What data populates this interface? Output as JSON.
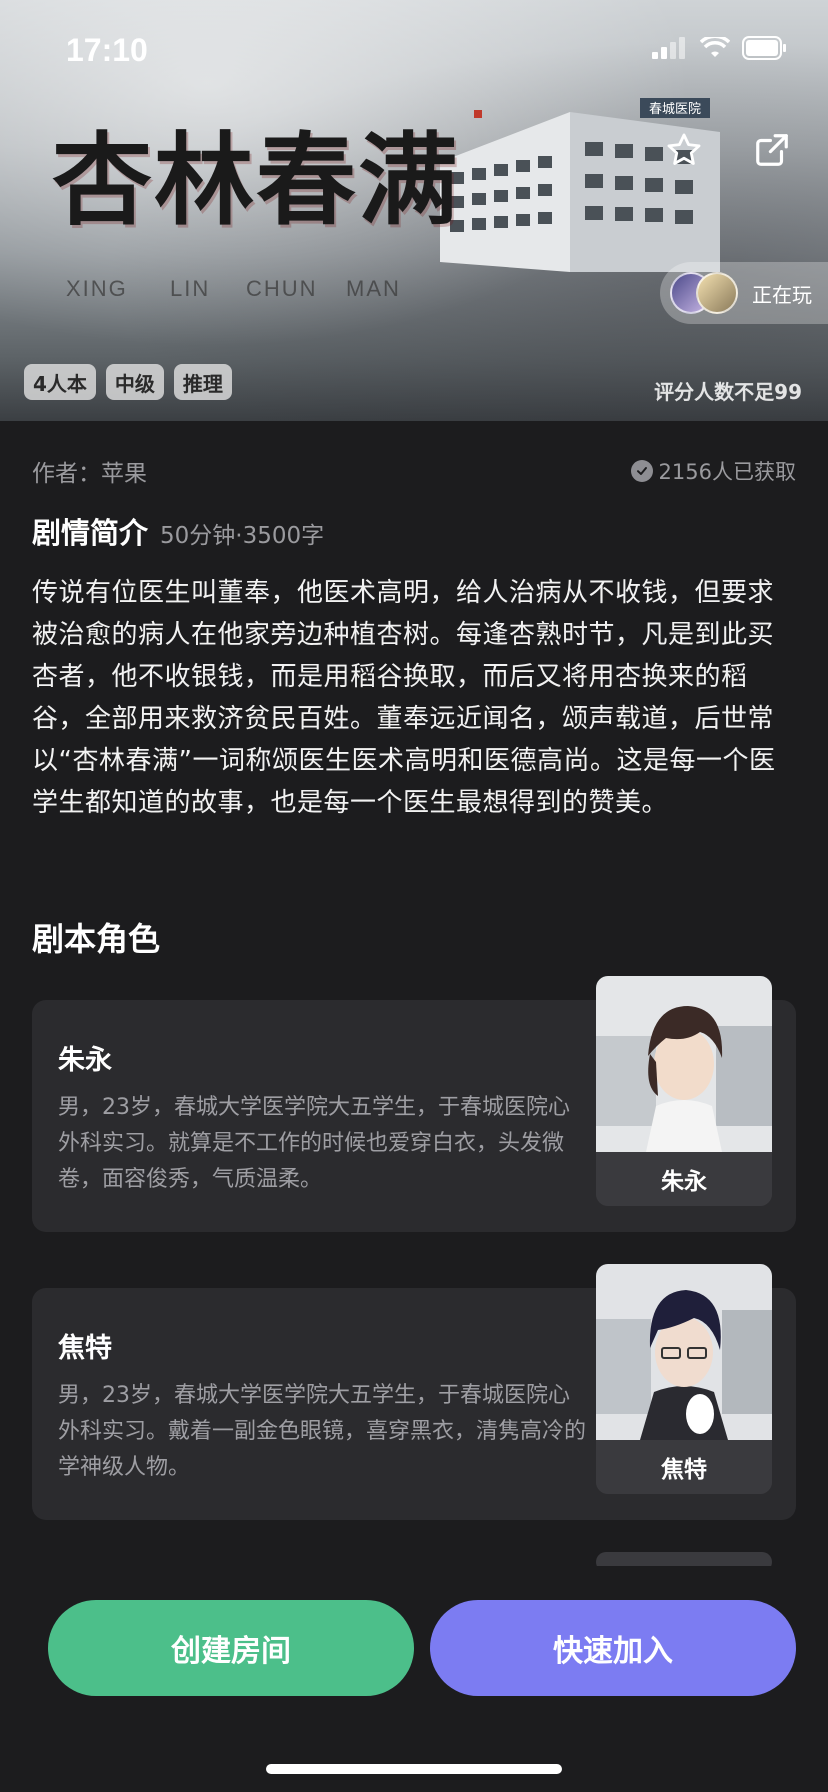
{
  "status_bar": {
    "time": "17:10"
  },
  "banner": {
    "title": "杏林春满",
    "pinyin": [
      "XING",
      "LIN",
      "CHUN",
      "MAN"
    ],
    "building_sign": "春城医院",
    "playing_label": "正在玩",
    "tags": [
      "4人本",
      "中级",
      "推理"
    ],
    "rating_note": "评分人数不足99"
  },
  "meta": {
    "author": "作者：苹果",
    "obtained": "2156人已获取"
  },
  "synopsis": {
    "title": "剧情简介",
    "meta": "50分钟·3500字",
    "body": "传说有位医生叫董奉，他医术高明，给人治病从不收钱，但要求被治愈的病人在他家旁边种植杏树。每逢杏熟时节，凡是到此买杏者，他不收银钱，而是用稻谷换取，而后又将用杏换来的稻谷，全部用来救济贫民百姓。董奉远近闻名，颂声载道，后世常以“杏林春满”一词称颂医生医术高明和医德高尚。这是每一个医学生都知道的故事，也是每一个医生最想得到的赞美。"
  },
  "roles": {
    "title": "剧本角色",
    "items": [
      {
        "name": "朱永",
        "desc": "男，23岁，春城大学医学院大五学生，于春城医院心外科实习。就算是不工作的时候也爱穿白衣，头发微卷，面容俊秀，气质温柔。",
        "portrait_label": "朱永"
      },
      {
        "name": "焦特",
        "desc": "男，23岁，春城大学医学院大五学生，于春城医院心外科实习。戴着一副金色眼镜，喜穿黑衣，清隽高冷的学神级人物。",
        "portrait_label": "焦特"
      }
    ]
  },
  "actions": {
    "create_label": "创建房间",
    "join_label": "快速加入"
  },
  "colors": {
    "background": "#1c1c1e",
    "card": "#2b2b2e",
    "create_button": "#4cbf8a",
    "join_button": "#7c7cf2"
  }
}
